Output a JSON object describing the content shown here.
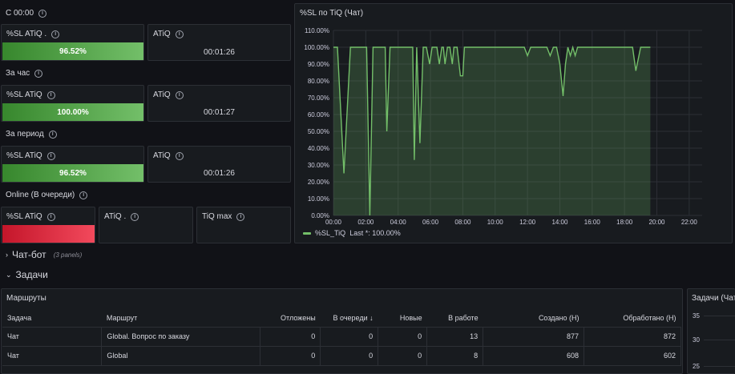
{
  "sections": {
    "s1": "С 00:00",
    "s2": "За час",
    "s3": "За период",
    "s4": "Online (В очереди)"
  },
  "stats": {
    "p1_sl_title": "%SL ATiQ .",
    "p1_sl_value": "96.52%",
    "p1_atiq_title": "ATiQ",
    "p1_atiq_value": "00:01:26",
    "p2_sl_title": "%SL ATiQ",
    "p2_sl_value": "100.00%",
    "p2_atiq_title": "ATiQ",
    "p2_atiq_value": "00:01:27",
    "p3_sl_title": "%SL ATiQ",
    "p3_sl_value": "96.52%",
    "p3_atiq_title": "ATiQ",
    "p3_atiq_value": "00:01:26",
    "p4_sl_title": "%SL ATiQ",
    "p4_atiq_title": "ATiQ .",
    "p4_tiqmax_title": "TiQ max"
  },
  "chart_panel": {
    "title": "%SL по TiQ (Чат)",
    "legend_label": "%SL_TiQ",
    "legend_last": "Last *: 100.00%"
  },
  "chart_data": {
    "type": "area",
    "title": "%SL по TiQ (Чат)",
    "xlabel": "",
    "ylabel": "",
    "ylim": [
      0,
      110
    ],
    "y_ticks": [
      "0.00%",
      "10.00%",
      "20.00%",
      "30.00%",
      "40.00%",
      "50.00%",
      "60.00%",
      "70.00%",
      "80.00%",
      "90.00%",
      "100.00%",
      "110.00%"
    ],
    "x_ticks": [
      "00:00",
      "02:00",
      "04:00",
      "06:00",
      "08:00",
      "10:00",
      "12:00",
      "14:00",
      "16:00",
      "18:00",
      "20:00",
      "22:00"
    ],
    "x_tick_hours": [
      0,
      2,
      4,
      6,
      8,
      10,
      12,
      14,
      16,
      18,
      20,
      22
    ],
    "xlim_hours": [
      0,
      22.8
    ],
    "grid": true,
    "legend_position": "bottom-left",
    "series": [
      {
        "name": "%SL_TiQ",
        "color": "#73bf69",
        "x_hours": [
          0,
          0.25,
          0.65,
          1.05,
          1.55,
          2.05,
          2.25,
          2.45,
          2.65,
          3.2,
          3.3,
          3.5,
          3.75,
          4.2,
          4.6,
          4.9,
          5.0,
          5.15,
          5.35,
          5.55,
          5.75,
          5.95,
          6.1,
          6.4,
          6.55,
          6.7,
          6.8,
          6.9,
          7.05,
          7.2,
          7.35,
          7.45,
          7.55,
          7.65,
          7.85,
          8.0,
          8.1,
          8.2,
          8.35,
          8.6,
          11.8,
          12.0,
          12.2,
          12.4,
          12.6,
          13.2,
          13.4,
          13.6,
          13.8,
          14.0,
          14.2,
          14.35,
          14.5,
          14.65,
          14.8,
          14.95,
          15.1,
          15.3,
          18.3,
          18.5,
          18.7,
          19.0,
          19.6
        ],
        "y_values": [
          100,
          100,
          25,
          100,
          100,
          100,
          0,
          100,
          100,
          100,
          50,
          100,
          100,
          100,
          100,
          100,
          33,
          100,
          43,
          100,
          100,
          90,
          100,
          100,
          90,
          100,
          100,
          90,
          100,
          100,
          90,
          100,
          100,
          100,
          83,
          83,
          100,
          100,
          100,
          100,
          100,
          95,
          100,
          100,
          100,
          100,
          95,
          100,
          100,
          90,
          71,
          90,
          100,
          95,
          100,
          95,
          100,
          100,
          100,
          100,
          86,
          100,
          100
        ]
      }
    ]
  },
  "collapsed_row": {
    "title": "Чат-бот",
    "note": "(3 panels)"
  },
  "expanded_row": {
    "title": "Задачи"
  },
  "routes_table": {
    "title": "Маршруты",
    "headers": [
      "Задача",
      "Маршрут",
      "Отложены",
      "В очереди",
      "Новые",
      "В работе",
      "Создано (Н)",
      "Обработано (Н)"
    ],
    "sort_indicator": "↓",
    "rows": [
      [
        "Чат",
        "Global. Вопрос по заказу",
        "0",
        "0",
        "0",
        "13",
        "877",
        "872"
      ],
      [
        "Чат",
        "Global",
        "0",
        "0",
        "0",
        "8",
        "608",
        "602"
      ]
    ]
  },
  "tasks_panel": {
    "title": "Задачи (Чат",
    "y_ticks": [
      "35",
      "30",
      "25"
    ]
  }
}
